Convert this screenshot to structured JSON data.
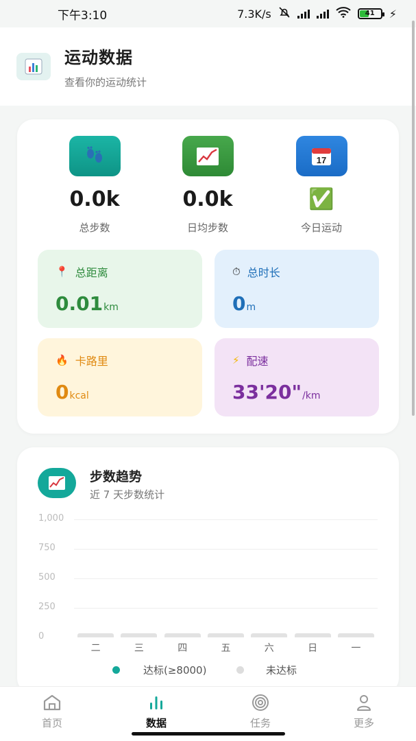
{
  "status_bar": {
    "time": "下午3:10",
    "net_speed": "7.3K/s",
    "battery": "41"
  },
  "header": {
    "title": "运动数据",
    "subtitle": "查看你的运动统计",
    "icon": "bar-chart-icon"
  },
  "summary": {
    "total_steps": {
      "value": "0.0k",
      "label": "总步数",
      "icon": "footprints-icon"
    },
    "avg_steps": {
      "value": "0.0k",
      "label": "日均步数",
      "icon": "trend-chart-icon"
    },
    "today": {
      "value": "✅",
      "label": "今日运动",
      "icon": "calendar-icon"
    }
  },
  "metrics": {
    "distance": {
      "label": "总距离",
      "value": "0.01",
      "unit": "km",
      "icon": "pin-icon",
      "color": "#2e8b3d",
      "bg": "#e8f6ea"
    },
    "duration": {
      "label": "总时长",
      "value": "0",
      "unit": "m",
      "icon": "stopwatch-icon",
      "color": "#1f6fb8",
      "bg": "#e3f0fc"
    },
    "calories": {
      "label": "卡路里",
      "value": "0",
      "unit": "kcal",
      "icon": "fire-icon",
      "color": "#e08a12",
      "bg": "#fff5dc"
    },
    "pace": {
      "label": "配速",
      "value": "33'20\"",
      "unit": "/km",
      "icon": "lightning-icon",
      "color": "#7b2f9e",
      "bg": "#f3e3f6"
    }
  },
  "trend": {
    "title": "步数趋势",
    "subtitle": "近 7 天步数统计",
    "icon": "trend-chart-icon"
  },
  "chart_data": {
    "type": "bar",
    "categories": [
      "二",
      "三",
      "四",
      "五",
      "六",
      "日",
      "一"
    ],
    "series": [
      {
        "values": [
          0,
          0,
          0,
          0,
          0,
          0,
          0
        ]
      }
    ],
    "y_ticks": [
      "1,000",
      "750",
      "500",
      "250",
      "0"
    ],
    "ylim": [
      0,
      1000
    ],
    "grid": true,
    "legend": [
      {
        "label": "达标(≥8000)",
        "color": "#14a89a"
      },
      {
        "label": "未达标",
        "color": "#dddddd"
      }
    ],
    "legend_position": "bottom"
  },
  "nav": {
    "items": [
      {
        "label": "首页",
        "icon": "home-icon"
      },
      {
        "label": "数据",
        "icon": "stats-icon"
      },
      {
        "label": "任务",
        "icon": "target-icon"
      },
      {
        "label": "更多",
        "icon": "user-icon"
      }
    ],
    "active_index": 1
  }
}
